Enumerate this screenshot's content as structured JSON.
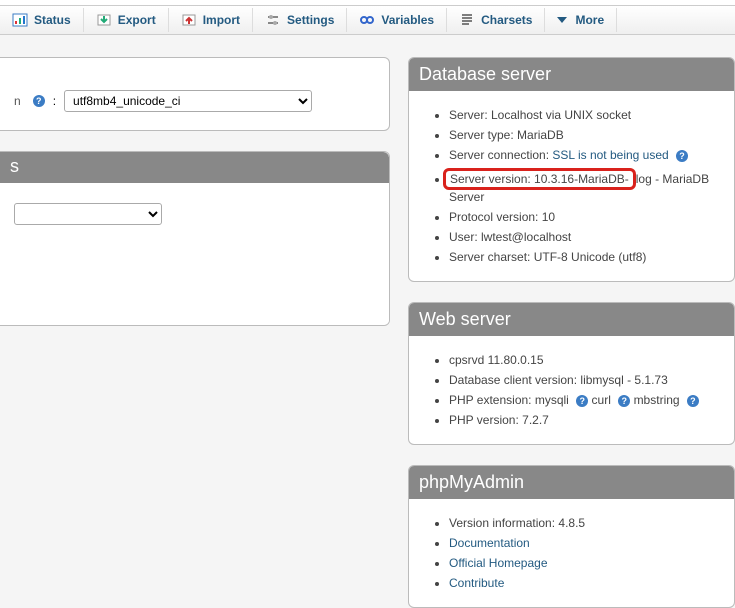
{
  "toolbar": {
    "status": "Status",
    "export": "Export",
    "import": "Import",
    "settings": "Settings",
    "variables": "Variables",
    "charsets": "Charsets",
    "more": "More"
  },
  "left": {
    "collation_selected": "utf8mb4_unicode_ci",
    "panel2_head_suffix": "s"
  },
  "db_server": {
    "title": "Database server",
    "server": "Server: Localhost via UNIX socket",
    "type": "Server type: MariaDB",
    "conn_label": "Server connection: ",
    "conn_value": "SSL is not being used",
    "version_boxed": "Server version: 10.3.16-MariaDB-",
    "version_rest": "log - MariaDB Server",
    "protocol": "Protocol version: 10",
    "user": "User: lwtest@localhost",
    "charset": "Server charset: UTF-8 Unicode (utf8)"
  },
  "web_server": {
    "title": "Web server",
    "srv": "cpsrvd 11.80.0.15",
    "client": "Database client version: libmysql - 5.1.73",
    "ext_label": "PHP extension: ",
    "ext1": "mysqli",
    "ext2": "curl",
    "ext3": "mbstring",
    "php": "PHP version: 7.2.7"
  },
  "pma": {
    "title": "phpMyAdmin",
    "version": "Version information: 4.8.5",
    "doc": "Documentation",
    "home": "Official Homepage",
    "contribute": "Contribute"
  }
}
